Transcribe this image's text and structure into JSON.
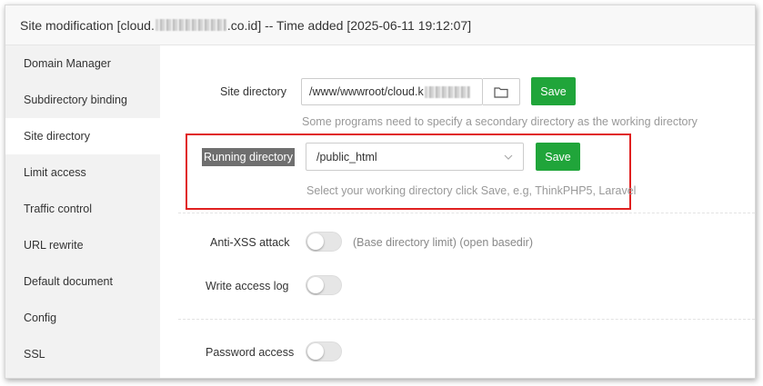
{
  "dialog": {
    "title_prefix": "Site modification [cloud.",
    "title_suffix": ".co.id] -- Time added [2025-06-11 19:12:07]"
  },
  "sidebar": {
    "items": [
      {
        "label": "Domain Manager"
      },
      {
        "label": "Subdirectory binding"
      },
      {
        "label": "Site directory",
        "active": true
      },
      {
        "label": "Limit access"
      },
      {
        "label": "Traffic control"
      },
      {
        "label": "URL rewrite"
      },
      {
        "label": "Default document"
      },
      {
        "label": "Config"
      },
      {
        "label": "SSL"
      }
    ]
  },
  "site_directory": {
    "label": "Site directory",
    "value": "/www/wwwroot/cloud.k",
    "save_label": "Save",
    "hint": "Some programs need to specify a secondary directory as the working directory",
    "folder_icon": "folder-icon"
  },
  "running_directory": {
    "label": "Running directory",
    "selected": "/public_html",
    "save_label": "Save",
    "hint": "Select your working directory click Save, e.g, ThinkPHP5, Laravel"
  },
  "anti_xss": {
    "label": "Anti-XSS attack",
    "enabled": false,
    "note": "(Base directory limit) (open basedir)"
  },
  "access_log": {
    "label": "Write access log",
    "enabled": false
  },
  "password_access": {
    "label": "Password access",
    "enabled": false
  },
  "colors": {
    "primary_green": "#20a53a",
    "highlight_red": "#e02020",
    "sidebar_bg": "#f2f2f2"
  }
}
